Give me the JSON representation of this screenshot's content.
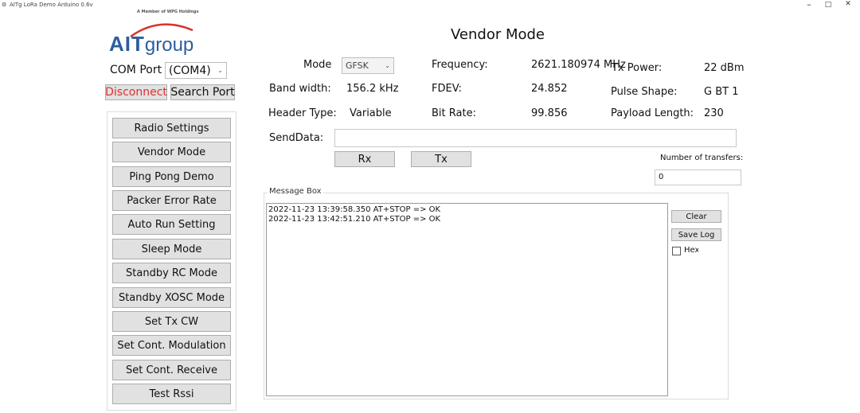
{
  "window": {
    "title": "AITg LoRa Demo Arduino 0.6v",
    "minimize": "–",
    "maximize": "□",
    "close": "✕"
  },
  "logo": {
    "tagline": "A Member of WPG Holdings",
    "brand_bold": "AIT",
    "brand_light": "group"
  },
  "connection": {
    "com_port_label": "COM Port",
    "com_port_value": "(COM4)",
    "disconnect_label": "Disconnect",
    "search_port_label": "Search Port"
  },
  "sidebar": {
    "items": [
      {
        "label": "Radio Settings"
      },
      {
        "label": "Vendor Mode"
      },
      {
        "label": "Ping Pong Demo"
      },
      {
        "label": "Packer Error Rate"
      },
      {
        "label": "Auto Run Setting"
      },
      {
        "label": "Sleep Mode"
      },
      {
        "label": "Standby RC Mode"
      },
      {
        "label": "Standby XOSC Mode"
      },
      {
        "label": "Set Tx CW"
      },
      {
        "label": "Set Cont. Modulation"
      },
      {
        "label": "Set Cont. Receive"
      },
      {
        "label": "Test Rssi"
      }
    ]
  },
  "main": {
    "title": "Vendor Mode",
    "mode_label": "Mode",
    "mode_value": "GFSK",
    "frequency_label": "Frequency:",
    "frequency_value": "2621.180974 MHz",
    "tx_power_label": "Tx Power:",
    "tx_power_value": "22 dBm",
    "bandwidth_label": "Band width:",
    "bandwidth_value": "156.2 kHz",
    "fdev_label": "FDEV:",
    "fdev_value": "24.852",
    "pulse_shape_label": "Pulse Shape:",
    "pulse_shape_value": "G BT 1",
    "header_type_label": "Header Type:",
    "header_type_value": "Variable",
    "bit_rate_label": "Bit Rate:",
    "bit_rate_value": "99.856",
    "payload_length_label": "Payload Length:",
    "payload_length_value": "230",
    "send_data_label": "SendData:",
    "send_data_value": "",
    "rx_label": "Rx",
    "tx_label": "Tx",
    "transfers_label": "Number of transfers:",
    "transfers_value": "0"
  },
  "message_box": {
    "label": "Message Box",
    "lines": [
      "2022-11-23 13:39:58.350 AT+STOP  => OK",
      "2022-11-23 13:42:51.210 AT+STOP  => OK"
    ],
    "clear_label": "Clear",
    "save_log_label": "Save Log",
    "hex_label": "Hex"
  },
  "colors": {
    "brand_blue": "#2c5d9e",
    "disconnect_red": "#e03030",
    "button_face": "#e1e1e1"
  }
}
